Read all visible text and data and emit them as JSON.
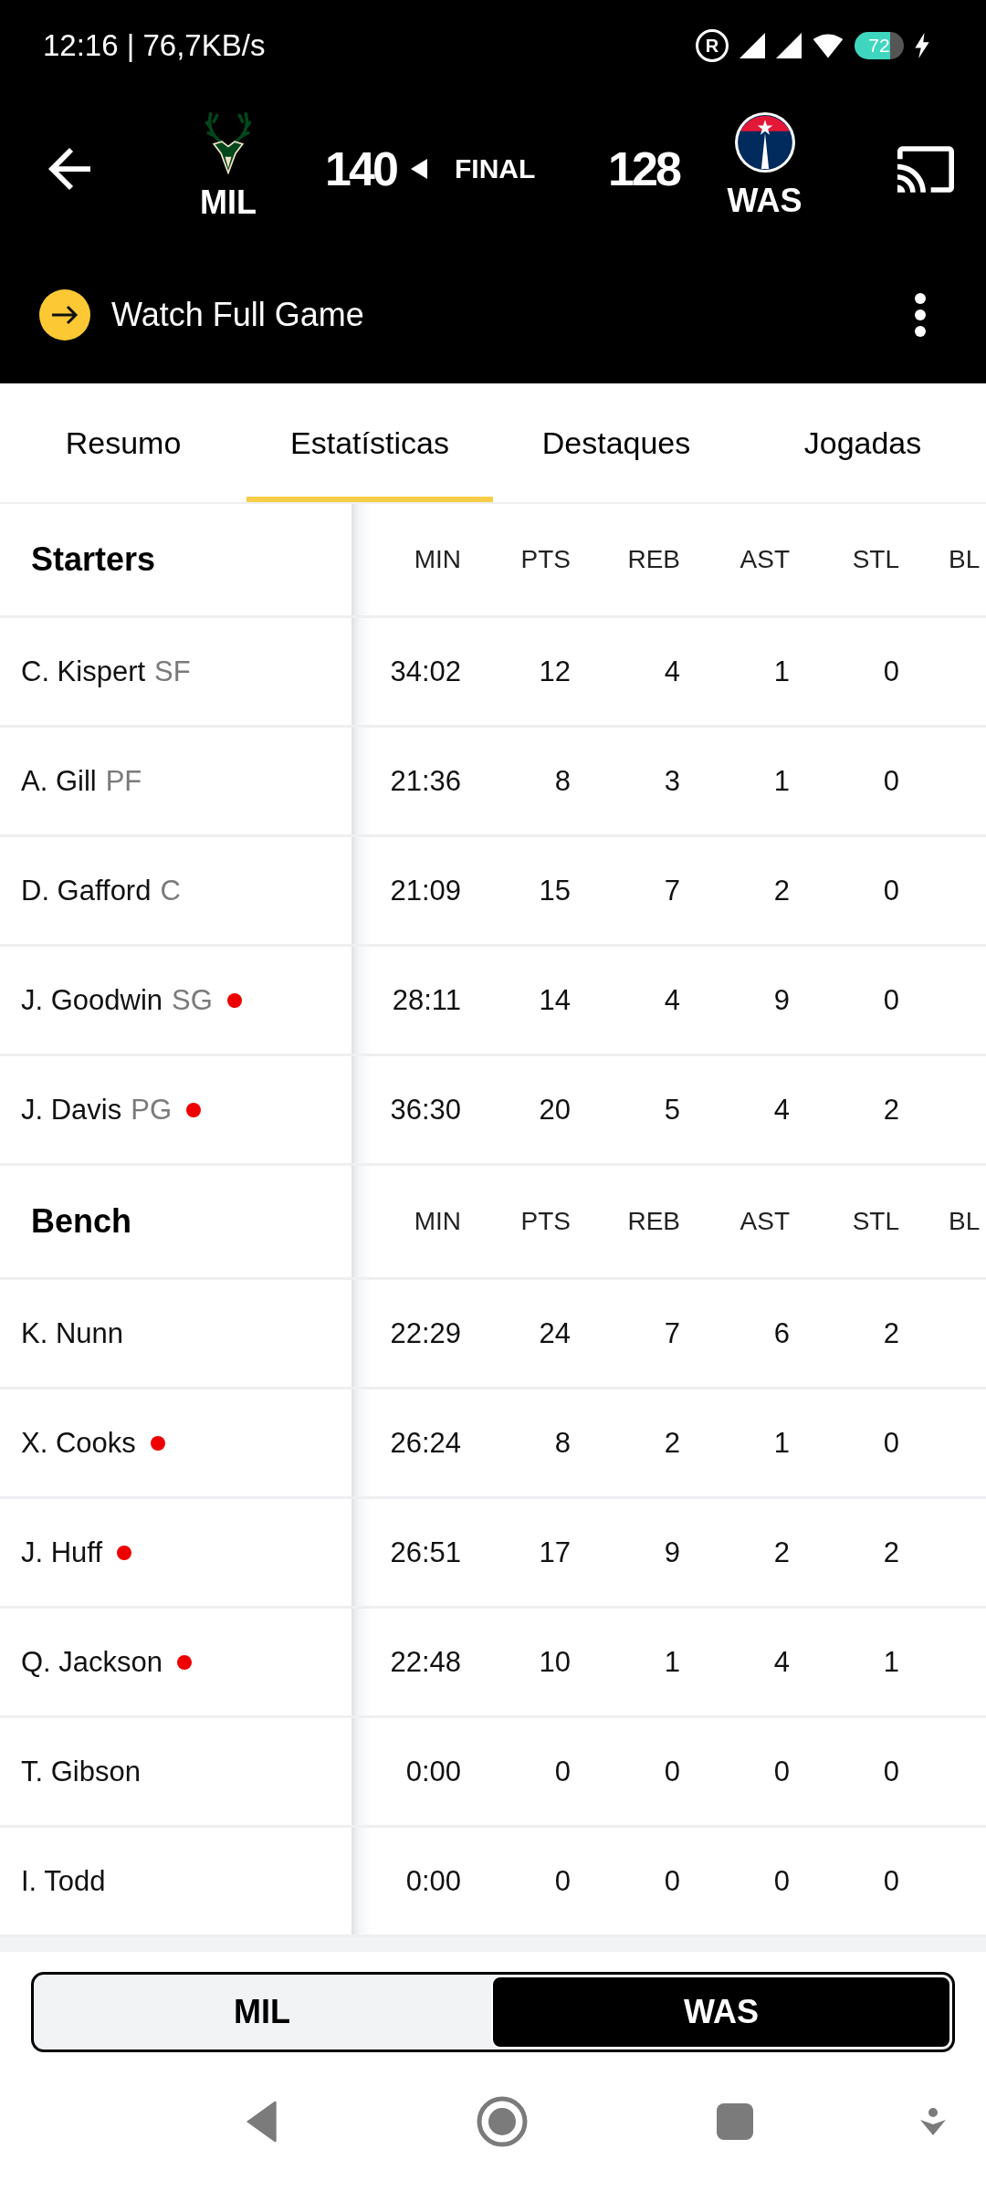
{
  "status_bar": {
    "text": "12:16 | 76,7KB/s",
    "registered_letter": "R",
    "battery": "72"
  },
  "game": {
    "teams": [
      {
        "abbr": "MIL",
        "score": "140",
        "winner": true
      },
      {
        "abbr": "WAS",
        "score": "128",
        "winner": false
      }
    ],
    "status": "FINAL"
  },
  "watch": {
    "label": "Watch Full Game"
  },
  "tabs": [
    {
      "label": "Resumo",
      "selected": false
    },
    {
      "label": "Estatísticas",
      "selected": true
    },
    {
      "label": "Destaques",
      "selected": false
    },
    {
      "label": "Jogadas",
      "selected": false
    }
  ],
  "box_score": {
    "sections": [
      {
        "title": "Starters",
        "columns": [
          "MIN",
          "PTS",
          "REB",
          "AST",
          "STL",
          "BL"
        ],
        "rows": [
          {
            "name": "C. Kispert",
            "position": "SF",
            "flagged": false,
            "stats": [
              "34:02",
              "12",
              "4",
              "1",
              "0"
            ]
          },
          {
            "name": "A. Gill",
            "position": "PF",
            "flagged": false,
            "stats": [
              "21:36",
              "8",
              "3",
              "1",
              "0"
            ]
          },
          {
            "name": "D. Gafford",
            "position": "C",
            "flagged": false,
            "stats": [
              "21:09",
              "15",
              "7",
              "2",
              "0"
            ]
          },
          {
            "name": "J. Goodwin",
            "position": "SG",
            "flagged": true,
            "stats": [
              "28:11",
              "14",
              "4",
              "9",
              "0"
            ]
          },
          {
            "name": "J. Davis",
            "position": "PG",
            "flagged": true,
            "stats": [
              "36:30",
              "20",
              "5",
              "4",
              "2"
            ]
          }
        ]
      },
      {
        "title": "Bench",
        "columns": [
          "MIN",
          "PTS",
          "REB",
          "AST",
          "STL",
          "BL"
        ],
        "rows": [
          {
            "name": "K. Nunn",
            "flagged": false,
            "stats": [
              "22:29",
              "24",
              "7",
              "6",
              "2"
            ]
          },
          {
            "name": "X. Cooks",
            "flagged": true,
            "stats": [
              "26:24",
              "8",
              "2",
              "1",
              "0"
            ]
          },
          {
            "name": "J. Huff",
            "flagged": true,
            "stats": [
              "26:51",
              "17",
              "9",
              "2",
              "2"
            ]
          },
          {
            "name": "Q. Jackson",
            "flagged": true,
            "stats": [
              "22:48",
              "10",
              "1",
              "4",
              "1"
            ]
          },
          {
            "name": "T. Gibson",
            "flagged": false,
            "stats": [
              "0:00",
              "0",
              "0",
              "0",
              "0"
            ]
          },
          {
            "name": "I. Todd",
            "flagged": false,
            "stats": [
              "0:00",
              "0",
              "0",
              "0",
              "0"
            ]
          }
        ]
      }
    ]
  },
  "team_toggle": [
    {
      "label": "MIL",
      "selected": false
    },
    {
      "label": "WAS",
      "selected": true
    }
  ]
}
